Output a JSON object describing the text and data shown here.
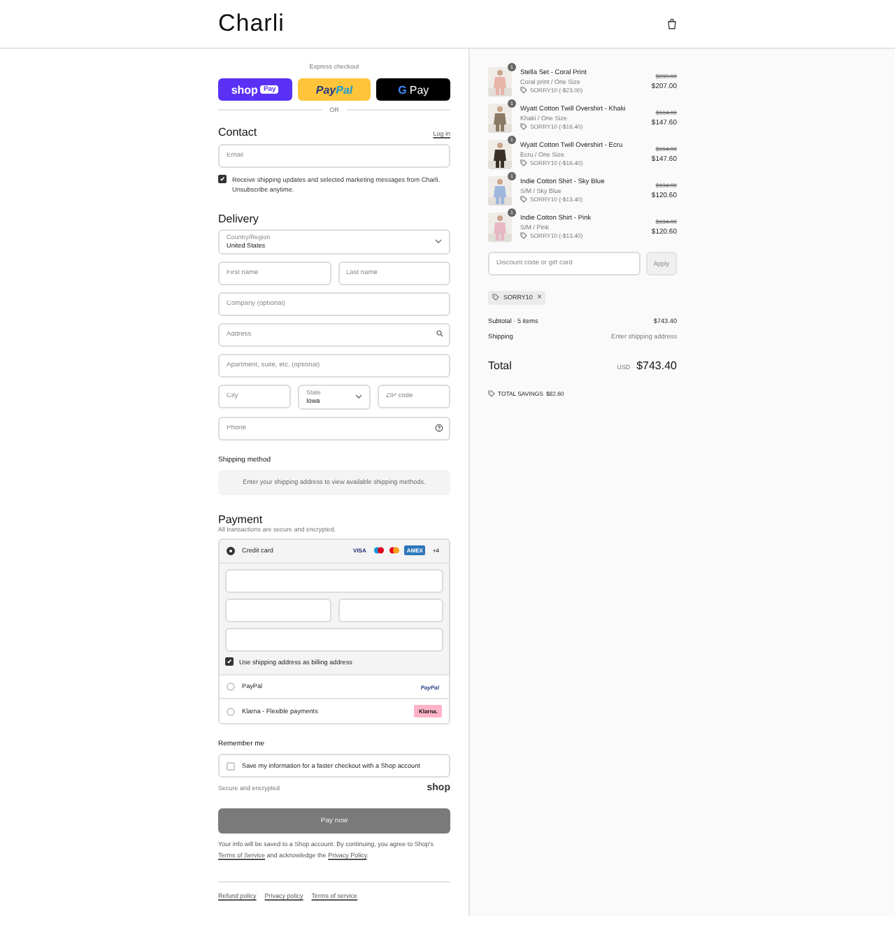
{
  "header": {
    "logo": "Charli"
  },
  "express": {
    "label": "Express checkout",
    "buttons": [
      {
        "kind": "shop",
        "text": "shop",
        "badge": "Pay"
      },
      {
        "kind": "paypal",
        "text": "Pay",
        "accent": "Pal"
      },
      {
        "kind": "gpay",
        "text": "G",
        "accent": "Pay"
      }
    ],
    "divider": "OR"
  },
  "contact": {
    "title": "Contact",
    "link": "Log in",
    "email": {
      "placeholder": "Email"
    },
    "marketing": {
      "label": "Receive shipping updates and selected marketing messages from Charli. Unsubscribe anytime.",
      "checked": true
    }
  },
  "delivery": {
    "title": "Delivery",
    "country": {
      "label": "Country/Region",
      "value": "United States"
    },
    "fields": [
      [
        {
          "kind": "text",
          "placeholder": "First name"
        },
        {
          "kind": "text",
          "placeholder": "Last name"
        }
      ],
      [
        {
          "kind": "text",
          "placeholder": "Company (optional)"
        }
      ],
      [
        {
          "kind": "search",
          "placeholder": "Address"
        }
      ],
      [
        {
          "kind": "text",
          "placeholder": "Apartment, suite, etc. (optional)"
        }
      ],
      [
        {
          "kind": "text",
          "placeholder": "City"
        },
        {
          "kind": "select",
          "label": "State",
          "value": "Iowa"
        },
        {
          "kind": "text",
          "placeholder": "ZIP code"
        }
      ],
      [
        {
          "kind": "help",
          "placeholder": "Phone"
        }
      ]
    ]
  },
  "shipping_method": {
    "title": "Shipping method",
    "message": "Enter your shipping address to view available shipping methods."
  },
  "payment": {
    "title": "Payment",
    "subtitle": "All transactions are secure and encrypted.",
    "methods": [
      {
        "kind": "card",
        "label": "Credit card",
        "selected": true,
        "logos": [
          {
            "kind": "visa",
            "text": "VISA"
          },
          {
            "kind": "maestro"
          },
          {
            "kind": "mastercard"
          },
          {
            "kind": "amex",
            "text": "AMEX"
          },
          {
            "kind": "more",
            "text": "+4"
          }
        ],
        "billing": {
          "label": "Use shipping address as billing address",
          "checked": true
        }
      },
      {
        "kind": "paypal",
        "label": "PayPal",
        "selected": false,
        "logo": "PayPal"
      },
      {
        "kind": "klarna",
        "label": "Klarna - Flexible payments",
        "selected": false,
        "logo": "Klarna."
      }
    ]
  },
  "remember": {
    "title": "Remember me",
    "label": "Save my information for a faster checkout with a Shop account",
    "checked": false,
    "secure": "Secure and encrypted",
    "brand": "shop"
  },
  "pay_button": "Pay now",
  "legal": [
    {
      "kind": "text",
      "text": "Your info will be saved to a Shop account. By continuing, you agree to Shop's"
    },
    {
      "kind": "link",
      "text": "Terms of Service"
    },
    {
      "kind": "text",
      "text": "and acknowledge the"
    },
    {
      "kind": "link",
      "text": "Privacy Policy"
    },
    {
      "kind": "text",
      "text": "."
    }
  ],
  "footer_links": [
    "Refund policy",
    "Privacy policy",
    "Terms of service"
  ],
  "cart": {
    "items": [
      {
        "name": "Stella Set - Coral Print",
        "variant": "Coral print / One Size",
        "discount": "SORRY10 (-$23.00)",
        "compare": "$230.00",
        "price": "$207.00",
        "quantity": "1"
      },
      {
        "name": "Wyatt Cotton Twill Overshirt - Khaki",
        "variant": "Khaki / One Size",
        "discount": "SORRY10 (-$16.40)",
        "compare": "$164.00",
        "price": "$147.60",
        "quantity": "1"
      },
      {
        "name": "Wyatt Cotton Twill Overshirt - Ecru",
        "variant": "Ecru / One Size",
        "discount": "SORRY10 (-$16.40)",
        "compare": "$164.00",
        "price": "$147.60",
        "quantity": "1"
      },
      {
        "name": "Indie Cotton Shirt - Sky Blue",
        "variant": "S/M / Sky Blue",
        "discount": "SORRY10 (-$13.40)",
        "compare": "$134.00",
        "price": "$120.60",
        "quantity": "1"
      },
      {
        "name": "Indie Cotton Shirt - Pink",
        "variant": "S/M / Pink",
        "discount": "SORRY10 (-$13.40)",
        "compare": "$134.00",
        "price": "$120.60",
        "quantity": "1"
      }
    ],
    "discount_field": {
      "placeholder": "Discount code or gift card"
    },
    "apply": "Apply",
    "code": "SORRY10",
    "remove": "×",
    "subtotal": {
      "label": "Subtotal · 5 items",
      "value": "$743.40"
    },
    "shipping": {
      "label": "Shipping",
      "value": "Enter shipping address"
    },
    "total": {
      "label": "Total",
      "currency": "USD",
      "value": "$743.40"
    },
    "savings": {
      "label": "TOTAL SAVINGS",
      "value": "$82.60"
    }
  }
}
